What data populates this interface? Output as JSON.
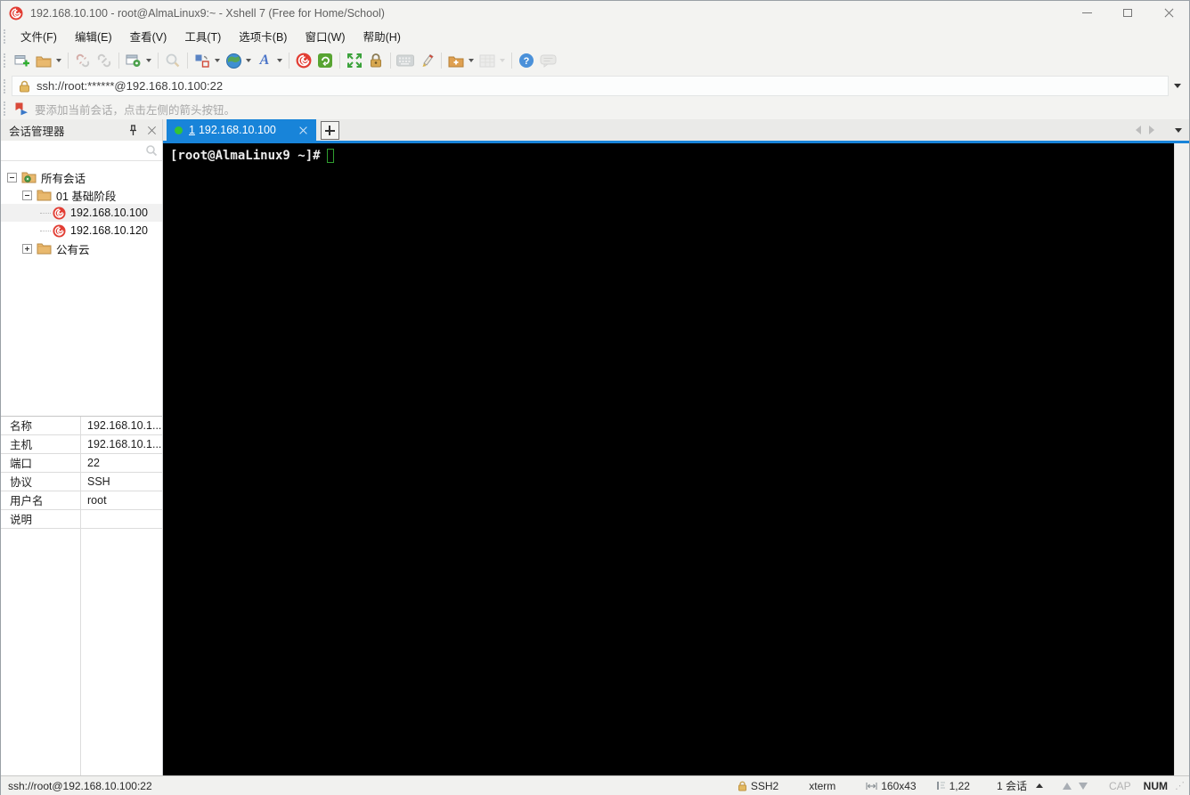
{
  "window": {
    "title": "192.168.10.100 - root@AlmaLinux9:~ - Xshell 7 (Free for Home/School)"
  },
  "menu": {
    "items": [
      "文件(F)",
      "编辑(E)",
      "查看(V)",
      "工具(T)",
      "选项卡(B)",
      "窗口(W)",
      "帮助(H)"
    ]
  },
  "toolbar": {
    "buttons": [
      "new-session",
      "open",
      "disconnect",
      "reconnect",
      "tab-properties",
      "find",
      "layout",
      "encoding",
      "font",
      "new-xshell",
      "xftp",
      "fullscreen",
      "lock-screen",
      "virtual-keyboard",
      "highlight",
      "new-session-folder",
      "compose-grid",
      "help",
      "feedback"
    ]
  },
  "address_bar": {
    "value": "ssh://root:******@192.168.10.100:22"
  },
  "info_bar": {
    "text": "要添加当前会话，点击左侧的箭头按钮。"
  },
  "session_manager": {
    "title": "会话管理器",
    "search_value": "",
    "tree": [
      {
        "label": "所有会话",
        "level": 0,
        "expanded": true,
        "icon": "folder-gear"
      },
      {
        "label": "01 基础阶段",
        "level": 1,
        "expanded": true,
        "icon": "folder"
      },
      {
        "label": "192.168.10.100",
        "level": 2,
        "icon": "xshell-session"
      },
      {
        "label": "192.168.10.120",
        "level": 2,
        "icon": "xshell-session"
      },
      {
        "label": "公有云",
        "level": 1,
        "expanded": false,
        "icon": "folder"
      }
    ],
    "properties": [
      {
        "label": "名称",
        "value": "192.168.10.1..."
      },
      {
        "label": "主机",
        "value": "192.168.10.1..."
      },
      {
        "label": "端口",
        "value": "22"
      },
      {
        "label": "协议",
        "value": "SSH"
      },
      {
        "label": "用户名",
        "value": "root"
      },
      {
        "label": "说明",
        "value": ""
      }
    ]
  },
  "tabs": {
    "active": {
      "index": "1",
      "label": "192.168.10.100"
    }
  },
  "terminal": {
    "prompt": "[root@AlmaLinux9 ~]#"
  },
  "status_bar": {
    "left": "ssh://root@192.168.10.100:22",
    "protocol": "SSH2",
    "term_type": "xterm",
    "size": "160x43",
    "cursor_pos": "1,22",
    "sessions": "1 会话",
    "cap": "CAP",
    "num": "NUM"
  },
  "colors": {
    "accent_blue": "#1884d9",
    "tab_green": "#35c435",
    "xshell_red": "#e23d33",
    "terminal_bg": "#000000",
    "cursor_green": "#2f9e2f"
  }
}
